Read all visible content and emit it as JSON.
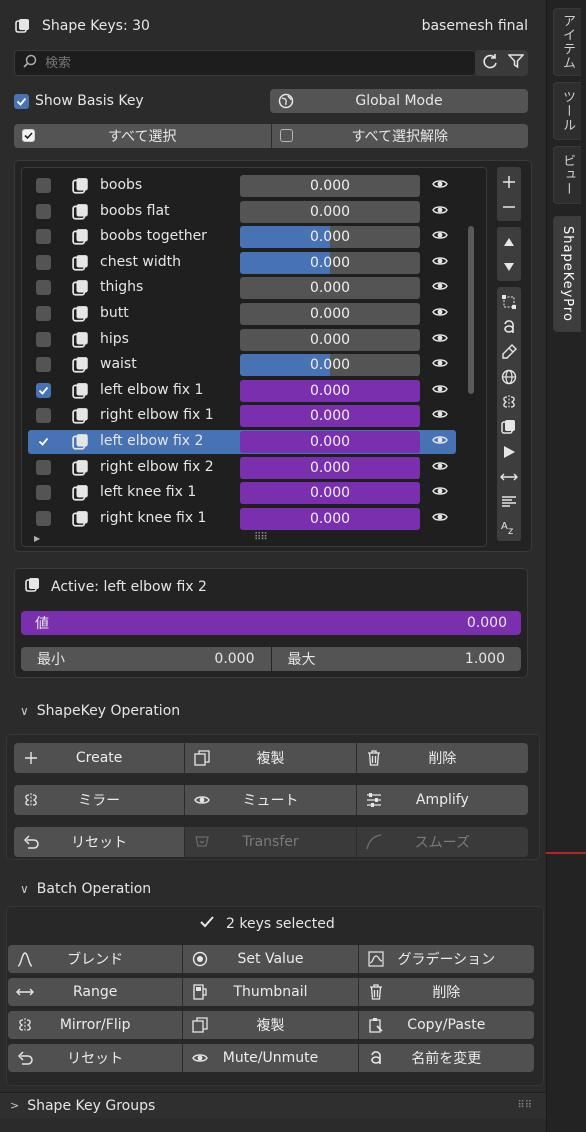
{
  "header": {
    "title": "Shape Keys: 30",
    "mesh_name": "basemesh final"
  },
  "search": {
    "placeholder": "検索"
  },
  "basis": {
    "show_basis_label": "Show Basis Key",
    "show_basis_checked": true,
    "global_mode_label": "Global Mode"
  },
  "selection": {
    "select_all_label": "すべて選択",
    "deselect_all_label": "すべて選択解除"
  },
  "shape_keys": [
    {
      "name": "boobs",
      "value": "0.000",
      "checked": false,
      "fill": 0,
      "color": "none"
    },
    {
      "name": "boobs flat",
      "value": "0.000",
      "checked": false,
      "fill": 0,
      "color": "none"
    },
    {
      "name": "boobs together",
      "value": "0.000",
      "checked": false,
      "fill": 0.5,
      "color": "blue"
    },
    {
      "name": "chest width",
      "value": "0.000",
      "checked": false,
      "fill": 0.5,
      "color": "blue"
    },
    {
      "name": "thighs",
      "value": "0.000",
      "checked": false,
      "fill": 0,
      "color": "none"
    },
    {
      "name": "butt",
      "value": "0.000",
      "checked": false,
      "fill": 0,
      "color": "none"
    },
    {
      "name": "hips",
      "value": "0.000",
      "checked": false,
      "fill": 0,
      "color": "none"
    },
    {
      "name": "waist",
      "value": "0.000",
      "checked": false,
      "fill": 0.5,
      "color": "blue"
    },
    {
      "name": "left elbow fix 1",
      "value": "0.000",
      "checked": true,
      "fill": 1,
      "color": "purple"
    },
    {
      "name": "right elbow fix 1",
      "value": "0.000",
      "checked": false,
      "fill": 1,
      "color": "purple"
    },
    {
      "name": "left elbow fix 2",
      "value": "0.000",
      "checked": true,
      "fill": 1,
      "color": "purple",
      "active": true
    },
    {
      "name": "right elbow fix 2",
      "value": "0.000",
      "checked": false,
      "fill": 1,
      "color": "purple"
    },
    {
      "name": "left knee fix 1",
      "value": "0.000",
      "checked": false,
      "fill": 1,
      "color": "purple"
    },
    {
      "name": "right knee fix 1",
      "value": "0.000",
      "checked": false,
      "fill": 1,
      "color": "purple"
    }
  ],
  "active": {
    "title": "Active: left elbow fix 2",
    "value_label": "値",
    "value": "0.000",
    "min_label": "最小",
    "min_value": "0.000",
    "max_label": "最大",
    "max_value": "1.000"
  },
  "shapekey_operation": {
    "title": "ShapeKey Operation",
    "rows": [
      [
        {
          "label": "Create",
          "icon": "plus-icon"
        },
        {
          "label": "複製",
          "icon": "duplicate-icon"
        },
        {
          "label": "削除",
          "icon": "trash-icon"
        }
      ],
      [
        {
          "label": "ミラー",
          "icon": "mirror-icon"
        },
        {
          "label": "ミュート",
          "icon": "eye-icon"
        },
        {
          "label": "Amplify",
          "icon": "sliders-icon"
        }
      ],
      [
        {
          "label": "リセット",
          "icon": "undo-icon"
        },
        {
          "label": "Transfer",
          "icon": "transfer-icon",
          "disabled": true
        },
        {
          "label": "スムーズ",
          "icon": "smooth-icon",
          "disabled": true
        }
      ]
    ]
  },
  "batch_operation": {
    "title": "Batch Operation",
    "keys_selected": "2 keys selected",
    "rows": [
      [
        {
          "label": "ブレンド",
          "icon": "blend-curve-icon"
        },
        {
          "label": "Set Value",
          "icon": "target-icon"
        },
        {
          "label": "グラデーション",
          "icon": "gradient-icon"
        }
      ],
      [
        {
          "label": "Range",
          "icon": "range-arrows-icon"
        },
        {
          "label": "Thumbnail",
          "icon": "thumbnail-icon"
        },
        {
          "label": "削除",
          "icon": "trash-icon"
        }
      ],
      [
        {
          "label": "Mirror/Flip",
          "icon": "mirror-icon"
        },
        {
          "label": "複製",
          "icon": "duplicate-icon"
        },
        {
          "label": "Copy/Paste",
          "icon": "clipboard-icon"
        }
      ],
      [
        {
          "label": "リセット",
          "icon": "undo-icon"
        },
        {
          "label": "Mute/Unmute",
          "icon": "eye-icon"
        },
        {
          "label": "名前を変更",
          "icon": "rename-icon"
        }
      ]
    ]
  },
  "groups": {
    "title": "Shape Key Groups"
  },
  "side_tabs": [
    "アイテム",
    "ツール",
    "ビュー",
    "ShapeKeyPro"
  ],
  "colors": {
    "accent_blue": "#4772b3",
    "accent_purple": "#7a2fae",
    "panel_bg": "#2b2b2b"
  }
}
